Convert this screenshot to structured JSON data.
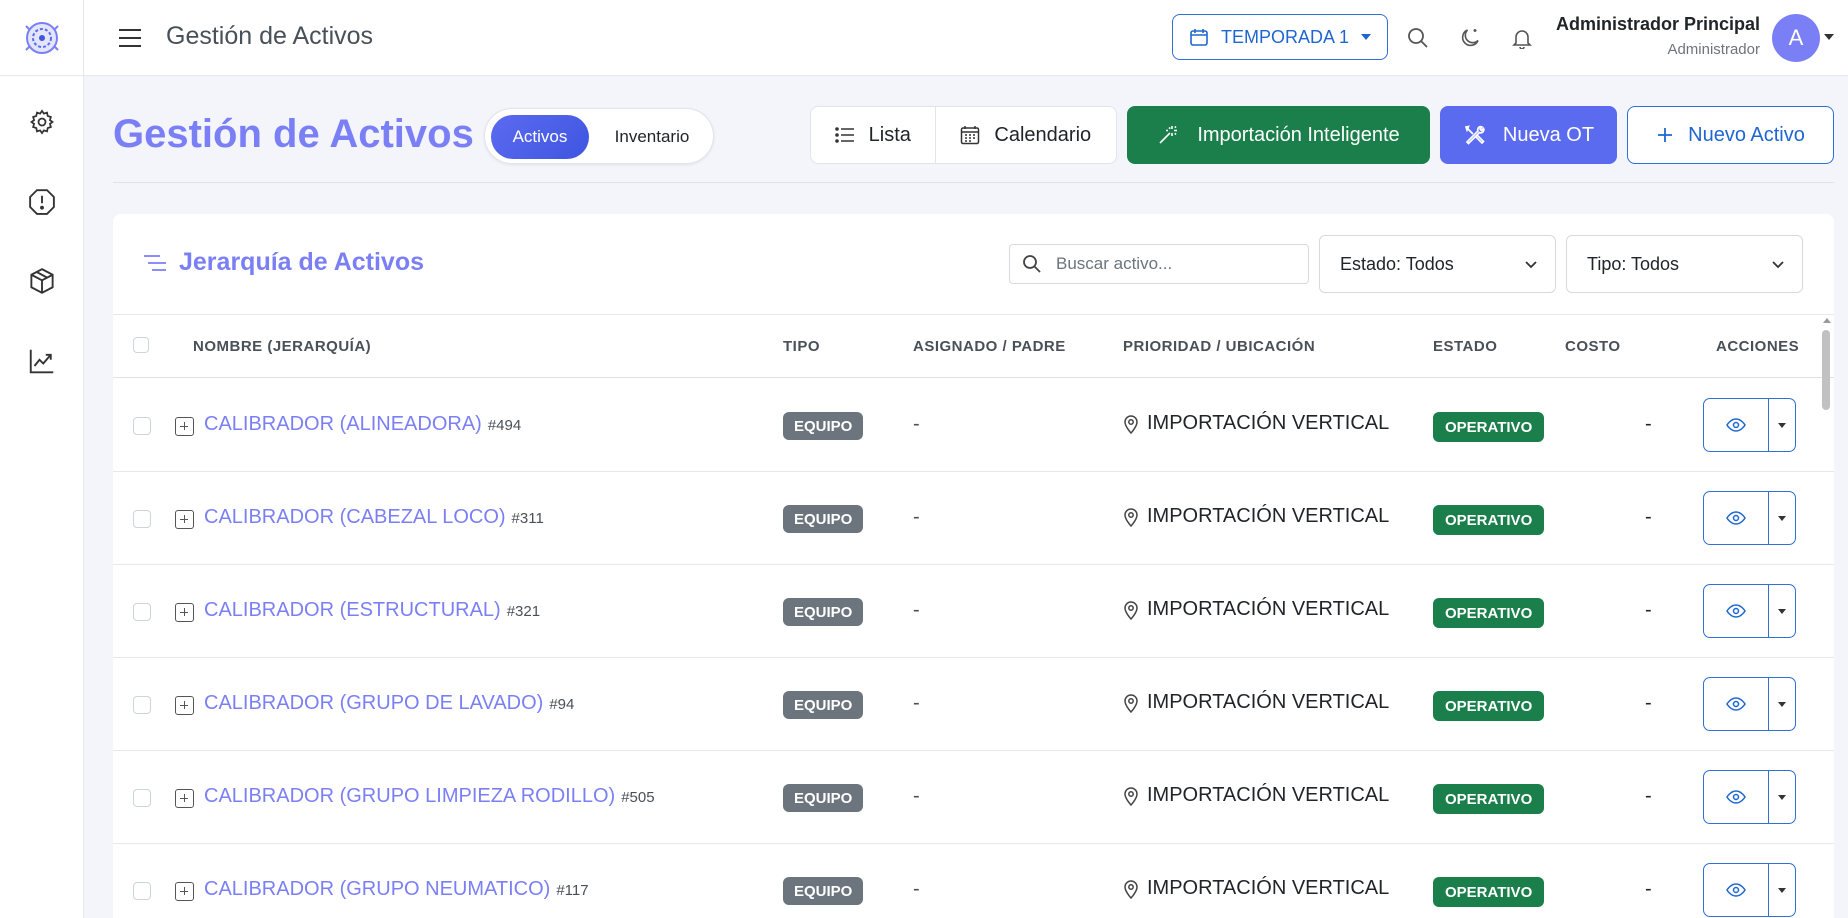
{
  "topbar": {
    "title": "Gestión de Activos",
    "season": "TEMPORADA 1",
    "user_name": "Administrador Principal",
    "user_role": "Administrador",
    "avatar_initial": "A"
  },
  "sidebar": {
    "items": [
      {
        "icon": "gear-icon"
      },
      {
        "icon": "alert-icon"
      },
      {
        "icon": "box-icon"
      },
      {
        "icon": "chart-icon"
      }
    ]
  },
  "page": {
    "title": "Gestión de Activos",
    "toggle": {
      "active": "Activos",
      "inactive": "Inventario"
    },
    "view_list": "Lista",
    "view_calendar": "Calendario",
    "import_btn": "Importación Inteligente",
    "new_ot_btn": "Nueva OT",
    "new_asset_btn": "Nuevo Activo"
  },
  "card": {
    "title": "Jerarquía de Activos",
    "search_placeholder": "Buscar activo...",
    "filter_estado": "Estado: Todos",
    "filter_tipo": "Tipo: Todos"
  },
  "table": {
    "headers": {
      "nombre": "NOMBRE (JERARQUÍA)",
      "tipo": "TIPO",
      "asignado": "ASIGNADO / PADRE",
      "prioridad": "PRIORIDAD / UBICACIÓN",
      "estado": "ESTADO",
      "costo": "COSTO",
      "acciones": "ACCIONES"
    },
    "rows": [
      {
        "name": "CALIBRADOR (ALINEADORA)",
        "id": "#494",
        "tipo": "EQUIPO",
        "asignado": "-",
        "ubicacion": "IMPORTACIÓN VERTICAL",
        "estado": "OPERATIVO",
        "costo": "-"
      },
      {
        "name": "CALIBRADOR (CABEZAL LOCO)",
        "id": "#311",
        "tipo": "EQUIPO",
        "asignado": "-",
        "ubicacion": "IMPORTACIÓN VERTICAL",
        "estado": "OPERATIVO",
        "costo": "-"
      },
      {
        "name": "CALIBRADOR (ESTRUCTURAL)",
        "id": "#321",
        "tipo": "EQUIPO",
        "asignado": "-",
        "ubicacion": "IMPORTACIÓN VERTICAL",
        "estado": "OPERATIVO",
        "costo": "-"
      },
      {
        "name": "CALIBRADOR (GRUPO DE LAVADO)",
        "id": "#94",
        "tipo": "EQUIPO",
        "asignado": "-",
        "ubicacion": "IMPORTACIÓN VERTICAL",
        "estado": "OPERATIVO",
        "costo": "-"
      },
      {
        "name": "CALIBRADOR (GRUPO LIMPIEZA RODILLO)",
        "id": "#505",
        "tipo": "EQUIPO",
        "asignado": "-",
        "ubicacion": "IMPORTACIÓN VERTICAL",
        "estado": "OPERATIVO",
        "costo": "-"
      },
      {
        "name": "CALIBRADOR (GRUPO NEUMATICO)",
        "id": "#117",
        "tipo": "EQUIPO",
        "asignado": "-",
        "ubicacion": "IMPORTACIÓN VERTICAL",
        "estado": "OPERATIVO",
        "costo": "-"
      }
    ]
  },
  "colors": {
    "accent": "#7b7ff6",
    "primary": "#5b6bf0",
    "success": "#1a7f4b",
    "outline_blue": "#2f6fd6",
    "badge_gray": "#6c757d"
  }
}
